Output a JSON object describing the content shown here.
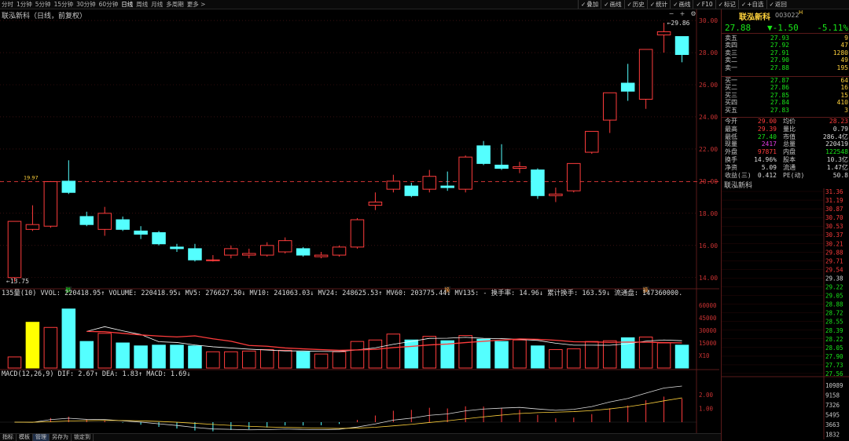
{
  "toolbar": {
    "periods": [
      {
        "label": "分时"
      },
      {
        "label": "1分钟"
      },
      {
        "label": "5分钟"
      },
      {
        "label": "15分钟"
      },
      {
        "label": "30分钟"
      },
      {
        "label": "60分钟"
      },
      {
        "label": "日线",
        "active": true
      },
      {
        "label": "周线"
      },
      {
        "label": "月线"
      },
      {
        "label": "多周期"
      },
      {
        "label": "更多 >"
      }
    ],
    "tools": [
      {
        "label": "叠加"
      },
      {
        "label": "画线"
      },
      {
        "label": "历史"
      },
      {
        "label": "统计"
      },
      {
        "label": "画线"
      },
      {
        "label": "F10"
      },
      {
        "label": "标记"
      },
      {
        "label": "+自选"
      },
      {
        "label": "返回"
      }
    ]
  },
  "chart": {
    "title": "联泓新科（日线，前复权）",
    "high_label": "29.86",
    "low_label": "13.75",
    "ref_label": "19.97",
    "markers": [
      "跌",
      "换",
      "换"
    ],
    "ma_line": {
      "text": "135量(10) VVOL: 220418.95↑ VOLUME: 220418.95↓ MV5: 276627.50↓ MV10: 241063.03↓ MV24: 248625.53↑ MV60: 203775.44↓ MV135: - 换手率: 14.96↓ 累计换手: 163.59↓ 流通盘: 147360000."
    },
    "macd_line": {
      "text": "MACD(12,26,9) DIF: 2.67↑ DEA: 1.83↑ MACD: 1.69↓"
    },
    "price_axis": [
      "30.00",
      "28.00",
      "26.00",
      "24.00",
      "22.00",
      "20.00",
      "18.00",
      "16.00",
      "14.00"
    ],
    "vol_axis": [
      "60000",
      "45000",
      "30000",
      "15000",
      "X10"
    ],
    "macd_axis": [
      "2.00",
      "1.00"
    ],
    "period_tag": "日线"
  },
  "colors": {
    "up": "#ff3c3c",
    "down": "#54ffff",
    "grid": "#5a1a1a",
    "ref": "#c83232",
    "ma5": "#ffffff",
    "ma10": "#ffd23c"
  },
  "chart_data": {
    "type": "candlestick",
    "candles": [
      {
        "o": 14.0,
        "c": 17.5,
        "h": 17.5,
        "l": 13.75
      },
      {
        "o": 17.0,
        "c": 17.3,
        "h": 18.5,
        "l": 16.9
      },
      {
        "o": 17.2,
        "c": 19.97,
        "h": 20.0,
        "l": 17.1
      },
      {
        "o": 20.0,
        "c": 19.3,
        "h": 21.3,
        "l": 19.2
      },
      {
        "o": 17.8,
        "c": 17.3,
        "h": 18.1,
        "l": 17.2
      },
      {
        "o": 17.0,
        "c": 18.0,
        "h": 18.4,
        "l": 16.6
      },
      {
        "o": 17.6,
        "c": 17.0,
        "h": 17.8,
        "l": 16.9
      },
      {
        "o": 16.9,
        "c": 16.7,
        "h": 17.2,
        "l": 16.4
      },
      {
        "o": 16.8,
        "c": 16.1,
        "h": 16.9,
        "l": 16.0
      },
      {
        "o": 15.9,
        "c": 15.8,
        "h": 16.1,
        "l": 15.6
      },
      {
        "o": 15.8,
        "c": 15.1,
        "h": 16.1,
        "l": 15.0
      },
      {
        "o": 15.1,
        "c": 15.1,
        "h": 15.4,
        "l": 15.0
      },
      {
        "o": 15.4,
        "c": 15.8,
        "h": 16.0,
        "l": 15.2
      },
      {
        "o": 15.4,
        "c": 15.5,
        "h": 15.8,
        "l": 15.2
      },
      {
        "o": 15.4,
        "c": 16.0,
        "h": 16.2,
        "l": 15.3
      },
      {
        "o": 15.6,
        "c": 16.3,
        "h": 16.5,
        "l": 15.5
      },
      {
        "o": 15.8,
        "c": 15.4,
        "h": 15.9,
        "l": 15.3
      },
      {
        "o": 15.3,
        "c": 15.4,
        "h": 15.6,
        "l": 15.2
      },
      {
        "o": 15.4,
        "c": 15.9,
        "h": 16.0,
        "l": 15.3
      },
      {
        "o": 15.9,
        "c": 17.6,
        "h": 17.7,
        "l": 15.8
      },
      {
        "o": 18.5,
        "c": 18.7,
        "h": 19.3,
        "l": 18.2
      },
      {
        "o": 19.5,
        "c": 20.0,
        "h": 20.4,
        "l": 19.3
      },
      {
        "o": 19.7,
        "c": 19.1,
        "h": 19.9,
        "l": 19.0
      },
      {
        "o": 19.5,
        "c": 20.3,
        "h": 20.7,
        "l": 19.3
      },
      {
        "o": 19.7,
        "c": 19.6,
        "h": 20.6,
        "l": 19.4
      },
      {
        "o": 19.5,
        "c": 21.5,
        "h": 21.6,
        "l": 19.3
      },
      {
        "o": 22.2,
        "c": 21.1,
        "h": 22.5,
        "l": 21.0
      },
      {
        "o": 21.0,
        "c": 20.8,
        "h": 22.3,
        "l": 20.7
      },
      {
        "o": 20.8,
        "c": 20.9,
        "h": 21.2,
        "l": 20.5
      },
      {
        "o": 20.7,
        "c": 19.1,
        "h": 20.8,
        "l": 18.9
      },
      {
        "o": 19.1,
        "c": 19.2,
        "h": 19.6,
        "l": 18.7
      },
      {
        "o": 19.4,
        "c": 21.1,
        "h": 21.1,
        "l": 19.3
      },
      {
        "o": 21.8,
        "c": 23.1,
        "h": 23.1,
        "l": 21.7
      },
      {
        "o": 23.8,
        "c": 25.5,
        "h": 25.5,
        "l": 23.0
      },
      {
        "o": 26.1,
        "c": 25.6,
        "h": 27.3,
        "l": 25.0
      },
      {
        "o": 25.1,
        "c": 28.2,
        "h": 28.2,
        "l": 24.5
      },
      {
        "o": 29.1,
        "c": 29.3,
        "h": 29.86,
        "l": 28.0
      },
      {
        "o": 29.0,
        "c": 27.88,
        "h": 29.0,
        "l": 27.4
      }
    ],
    "volumes": [
      15000,
      62000,
      55000,
      80000,
      36000,
      47000,
      34000,
      30000,
      31000,
      31000,
      30000,
      22000,
      22000,
      23000,
      25000,
      24000,
      22000,
      19000,
      22000,
      36000,
      38000,
      46000,
      38000,
      43000,
      37000,
      44000,
      39000,
      36000,
      38000,
      30000,
      25000,
      26000,
      36000,
      37000,
      41000,
      42000,
      34000,
      31000
    ],
    "ylim": [
      13.5,
      30.2
    ]
  },
  "quote": {
    "name": "联泓新科",
    "code": "003022",
    "hk": "H",
    "price": "27.88",
    "change": "▼-1.50",
    "pct": "-5.11%",
    "asks": [
      {
        "label": "卖五",
        "price": "27.93",
        "vol": "9"
      },
      {
        "label": "卖四",
        "price": "27.92",
        "vol": "47"
      },
      {
        "label": "卖三",
        "price": "27.91",
        "vol": "1280"
      },
      {
        "label": "卖二",
        "price": "27.90",
        "vol": "49"
      },
      {
        "label": "卖一",
        "price": "27.88",
        "vol": "195"
      }
    ],
    "bids": [
      {
        "label": "买一",
        "price": "27.87",
        "vol": "64"
      },
      {
        "label": "买二",
        "price": "27.86",
        "vol": "16"
      },
      {
        "label": "买三",
        "price": "27.85",
        "vol": "15"
      },
      {
        "label": "买四",
        "price": "27.84",
        "vol": "410"
      },
      {
        "label": "买五",
        "price": "27.83",
        "vol": "3"
      }
    ],
    "stats": [
      {
        "l1": "今开",
        "v1": "29.00",
        "c1": "red",
        "l2": "均价",
        "v2": "28.23",
        "c2": "red"
      },
      {
        "l1": "最高",
        "v1": "29.39",
        "c1": "red",
        "l2": "量比",
        "v2": "0.79",
        "c2": "white"
      },
      {
        "l1": "最低",
        "v1": "27.40",
        "c1": "green",
        "l2": "市值",
        "v2": "286.4亿",
        "c2": "white"
      },
      {
        "l1": "现量",
        "v1": "2417",
        "c1": "magenta",
        "l2": "总量",
        "v2": "220419",
        "c2": "white"
      },
      {
        "l1": "外盘",
        "v1": "97871",
        "c1": "red",
        "l2": "内盘",
        "v2": "122548",
        "c2": "green"
      },
      {
        "l1": "换手",
        "v1": "14.96%",
        "c1": "white",
        "l2": "股本",
        "v2": "10.3亿",
        "c2": "white"
      },
      {
        "l1": "净资",
        "v1": "5.09",
        "c1": "white",
        "l2": "流通",
        "v2": "1.47亿",
        "c2": "white"
      },
      {
        "l1": "收益(三)",
        "v1": "0.412",
        "c1": "white",
        "l2": "PE(动)",
        "v2": "50.8",
        "c2": "white"
      }
    ],
    "mini_title": "联泓新科",
    "mini_axis": [
      "31.36",
      "31.19",
      "30.87",
      "30.70",
      "30.53",
      "30.37",
      "30.21",
      "29.88",
      "29.71",
      "29.54",
      "29.38",
      "29.22",
      "29.05",
      "28.88",
      "28.72",
      "28.55",
      "28.39",
      "28.22",
      "28.05",
      "27.90",
      "27.73",
      "27.56"
    ],
    "mini_vol_axis": [
      "10989",
      "9158",
      "7326",
      "5495",
      "3663",
      "1832"
    ]
  },
  "bottom": {
    "tabs": [
      {
        "label": "指标"
      },
      {
        "label": "模板"
      },
      {
        "label": "管理",
        "active": true
      },
      {
        "label": "另存为"
      },
      {
        "label": "锁定到"
      }
    ]
  }
}
